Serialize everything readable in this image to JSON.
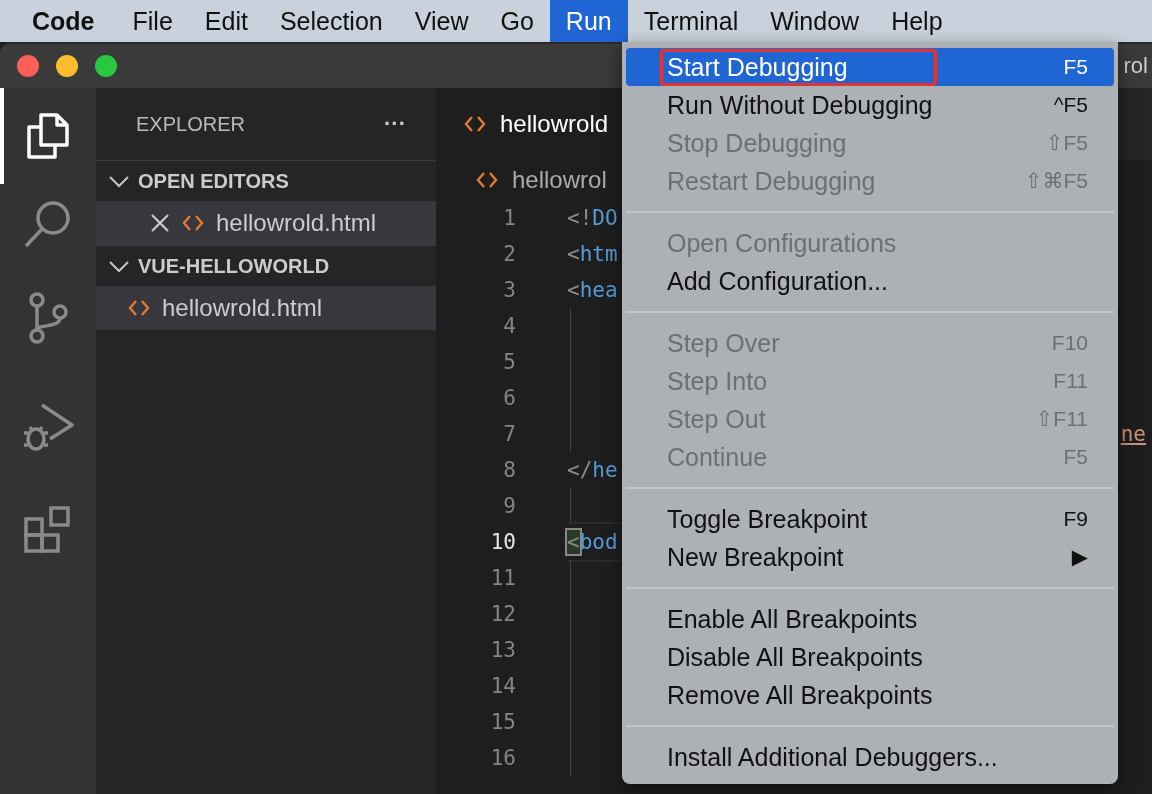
{
  "menubar": {
    "items": [
      {
        "label": "Code",
        "kind": "app",
        "selected": false
      },
      {
        "label": "File",
        "kind": "menu",
        "selected": false
      },
      {
        "label": "Edit",
        "kind": "menu",
        "selected": false
      },
      {
        "label": "Selection",
        "kind": "menu",
        "selected": false
      },
      {
        "label": "View",
        "kind": "menu",
        "selected": false
      },
      {
        "label": "Go",
        "kind": "menu",
        "selected": false
      },
      {
        "label": "Run",
        "kind": "menu",
        "selected": true
      },
      {
        "label": "Terminal",
        "kind": "menu",
        "selected": false
      },
      {
        "label": "Window",
        "kind": "menu",
        "selected": false
      },
      {
        "label": "Help",
        "kind": "menu",
        "selected": false
      }
    ]
  },
  "window": {
    "title": "rol"
  },
  "activity_bar": {
    "items": [
      {
        "kind": "files",
        "selected": true
      },
      {
        "kind": "search",
        "selected": false
      },
      {
        "kind": "source-control",
        "selected": false
      },
      {
        "kind": "run-debug",
        "selected": false
      },
      {
        "kind": "extensions",
        "selected": false
      }
    ]
  },
  "sidebar": {
    "title": "EXPLORER",
    "more": "···",
    "sections": [
      {
        "title": "OPEN EDITORS",
        "expanded": true,
        "items": [
          {
            "label": "hellowrold.html",
            "closable": true,
            "selected": true
          }
        ]
      },
      {
        "title": "VUE-HELLOWORLD",
        "expanded": true,
        "items": [
          {
            "label": "hellowrold.html",
            "closable": false,
            "selected": true
          }
        ]
      }
    ]
  },
  "editor": {
    "tab": "hellowrold",
    "breadcrumb": "hellowrol",
    "lines": [
      {
        "number": "1",
        "punct": "<!",
        "tag": "DO",
        "current": false
      },
      {
        "number": "2",
        "punct": "<",
        "tag": "htm",
        "current": false
      },
      {
        "number": "3",
        "punct": "<",
        "tag": "hea",
        "current": false
      },
      {
        "number": "4",
        "current": false
      },
      {
        "number": "5",
        "current": false
      },
      {
        "number": "6",
        "current": false
      },
      {
        "number": "7",
        "current": false,
        "overflow": "ne"
      },
      {
        "number": "8",
        "punct": "</",
        "tag": "he",
        "current": false
      },
      {
        "number": "9",
        "current": false
      },
      {
        "number": "10",
        "punct": "<",
        "tag": "bod",
        "current": true
      },
      {
        "number": "11",
        "current": false
      },
      {
        "number": "12",
        "current": false
      },
      {
        "number": "13",
        "current": false
      },
      {
        "number": "14",
        "current": false
      },
      {
        "number": "15",
        "current": false
      },
      {
        "number": "16",
        "current": false
      }
    ]
  },
  "run_menu": {
    "groups": [
      [
        {
          "label": "Start Debugging",
          "shortcut": "F5",
          "disabled": false,
          "selected": true,
          "outlined": true
        },
        {
          "label": "Run Without Debugging",
          "shortcut": "^F5",
          "disabled": false,
          "selected": false,
          "outlined": false
        },
        {
          "label": "Stop Debugging",
          "shortcut": "⇧F5",
          "disabled": true,
          "selected": false,
          "outlined": false
        },
        {
          "label": "Restart Debugging",
          "shortcut": "⇧⌘F5",
          "disabled": true,
          "selected": false,
          "outlined": false
        }
      ],
      [
        {
          "label": "Open Configurations",
          "disabled": true,
          "selected": false,
          "outlined": false
        },
        {
          "label": "Add Configuration...",
          "disabled": false,
          "selected": false,
          "outlined": false
        }
      ],
      [
        {
          "label": "Step Over",
          "shortcut": "F10",
          "disabled": true,
          "selected": false,
          "outlined": false
        },
        {
          "label": "Step Into",
          "shortcut": "F11",
          "disabled": true,
          "selected": false,
          "outlined": false
        },
        {
          "label": "Step Out",
          "shortcut": "⇧F11",
          "disabled": true,
          "selected": false,
          "outlined": false
        },
        {
          "label": "Continue",
          "shortcut": "F5",
          "disabled": true,
          "selected": false,
          "outlined": false
        }
      ],
      [
        {
          "label": "Toggle Breakpoint",
          "shortcut": "F9",
          "disabled": false,
          "selected": false,
          "outlined": false
        },
        {
          "label": "New Breakpoint",
          "shortcut": "▶",
          "disabled": false,
          "selected": false,
          "outlined": false
        }
      ],
      [
        {
          "label": "Enable All Breakpoints",
          "disabled": false,
          "selected": false,
          "outlined": false
        },
        {
          "label": "Disable All Breakpoints",
          "disabled": false,
          "selected": false,
          "outlined": false
        },
        {
          "label": "Remove All Breakpoints",
          "disabled": false,
          "selected": false,
          "outlined": false
        }
      ],
      [
        {
          "label": "Install Additional Debuggers...",
          "disabled": false,
          "selected": false,
          "outlined": false
        }
      ]
    ]
  }
}
